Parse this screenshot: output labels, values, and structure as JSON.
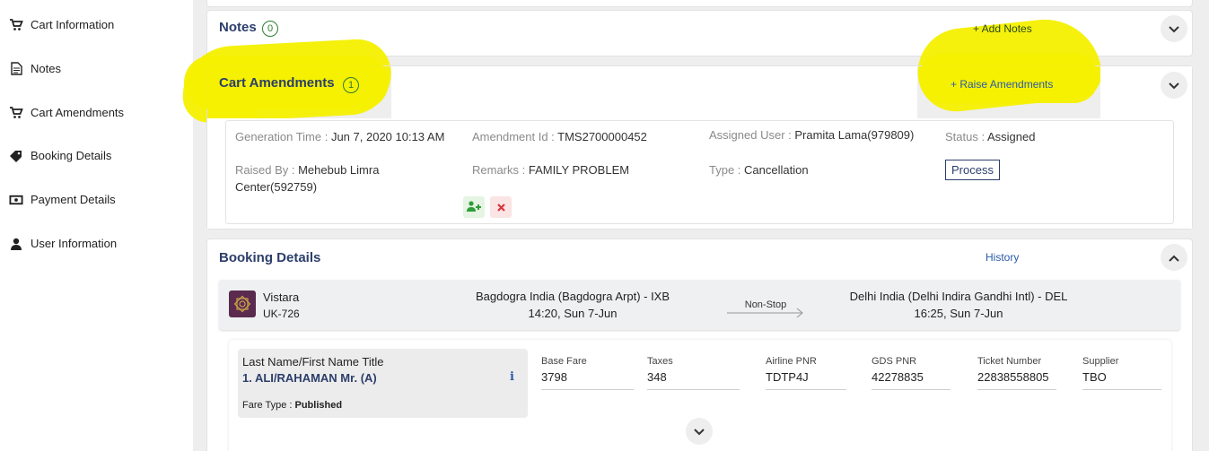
{
  "sidebar": {
    "items": [
      {
        "label": "Cart Information",
        "icon": "cart-icon"
      },
      {
        "label": "Notes",
        "icon": "document-icon"
      },
      {
        "label": "Cart Amendments",
        "icon": "cart-icon"
      },
      {
        "label": "Booking Details",
        "icon": "tag-icon"
      },
      {
        "label": "Payment Details",
        "icon": "money-icon"
      },
      {
        "label": "User Information",
        "icon": "user-icon"
      }
    ]
  },
  "notes": {
    "title": "Notes",
    "count": "0",
    "add_link": "+ Add Notes"
  },
  "amendments": {
    "title": "Cart Amendments",
    "count": "1",
    "raise_link": "+ Raise Amendments",
    "row": {
      "generation_time_label": "Generation Time : ",
      "generation_time": "Jun 7, 2020 10:13 AM",
      "amendment_id_label": "Amendment Id : ",
      "amendment_id": "TMS2700000452",
      "assigned_user_label": "Assigned User : ",
      "assigned_user": "Pramita Lama(979809)",
      "status_label": "Status : ",
      "status": "Assigned",
      "raised_by_label": "Raised By : ",
      "raised_by": "Mehebub Limra Center(592759)",
      "remarks_label": "Remarks : ",
      "remarks": "FAMILY PROBLEM",
      "type_label": "Type : ",
      "type": "Cancellation",
      "process_label": "Process"
    }
  },
  "booking": {
    "title": "Booking Details",
    "history_link": "History",
    "flight": {
      "airline": "Vistara",
      "flight_no": "UK-726",
      "origin": "Bagdogra India (Bagdogra Arpt) - IXB",
      "departure": "14:20, Sun 7-Jun",
      "stops": "Non-Stop",
      "destination": "Delhi India (Delhi Indira Gandhi Intl) - DEL",
      "arrival": "16:25, Sun 7-Jun"
    },
    "passenger": {
      "name_header": "Last Name/First Name Title",
      "name": "1. ALI/RAHAMAN Mr. (A)",
      "fare_type_label": "Fare Type : ",
      "fare_type": "Published",
      "columns": [
        {
          "header": "Base Fare",
          "value": "3798"
        },
        {
          "header": "Taxes",
          "value": "348"
        },
        {
          "header": "Airline PNR",
          "value": "TDTP4J"
        },
        {
          "header": "GDS PNR",
          "value": "42278835"
        },
        {
          "header": "Ticket Number",
          "value": "22838558805"
        },
        {
          "header": "Supplier",
          "value": "TBO"
        }
      ]
    }
  },
  "colors": {
    "accent": "#2c3e6b",
    "link": "#2a5aa8",
    "highlight": "#f4f000",
    "badge": "#2e7d32"
  }
}
